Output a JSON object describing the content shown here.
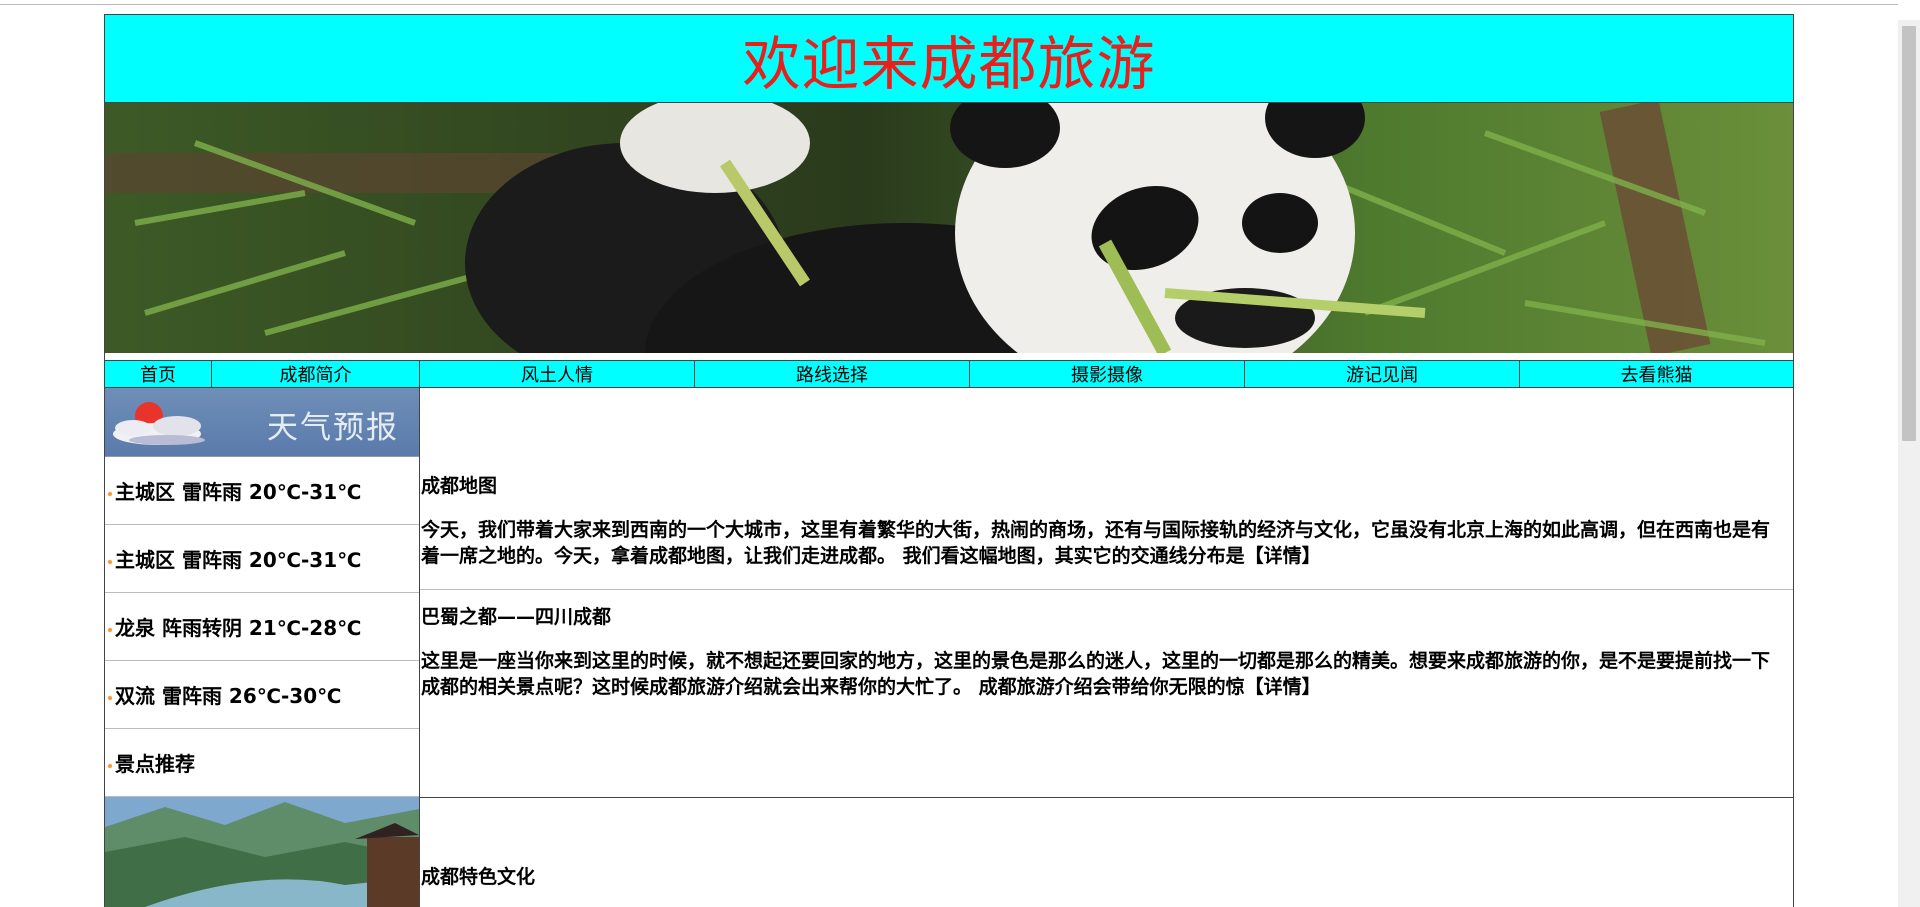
{
  "header": {
    "title": "欢迎来成都旅游"
  },
  "nav": {
    "items": [
      {
        "label": "首页"
      },
      {
        "label": "成都简介"
      },
      {
        "label": "风土人情"
      },
      {
        "label": "路线选择"
      },
      {
        "label": "摄影摄像"
      },
      {
        "label": "游记见闻"
      },
      {
        "label": "去看熊猫"
      }
    ]
  },
  "sidebar": {
    "weather_title": "天气预报",
    "items": [
      {
        "label": "主城区 雷阵雨 20℃-31℃"
      },
      {
        "label": "主城区 雷阵雨 20℃-31℃"
      },
      {
        "label": "龙泉 阵雨转阴 21℃-28℃"
      },
      {
        "label": "双流 雷阵雨 26℃-30℃"
      },
      {
        "label": "景点推荐"
      }
    ]
  },
  "main": {
    "sections": [
      {
        "title": "成都地图",
        "text": "今天，我们带着大家来到西南的一个大城市，这里有着繁华的大街，热闹的商场，还有与国际接轨的经济与文化，它虽没有北京上海的如此高调，但在西南也是有着一席之地的。今天，拿着成都地图，让我们走进成都。 我们看这幅地图，其实它的交通线分布是",
        "more": "【详情】"
      },
      {
        "title": "巴蜀之都——四川成都",
        "text": "这里是一座当你来到这里的时候，就不想起还要回家的地方，这里的景色是那么的迷人，这里的一切都是那么的精美。想要来成都旅游的你，是不是要提前找一下成都的相关景点呢？这时候成都旅游介绍就会出来帮你的大忙了。 成都旅游介绍会带给你无限的惊",
        "more": "【详情】"
      },
      {
        "title": "成都特色文化"
      }
    ]
  },
  "colors": {
    "header_bg": "#00ffff",
    "title_color": "#e8201b",
    "nav_bg": "#00ffff"
  }
}
